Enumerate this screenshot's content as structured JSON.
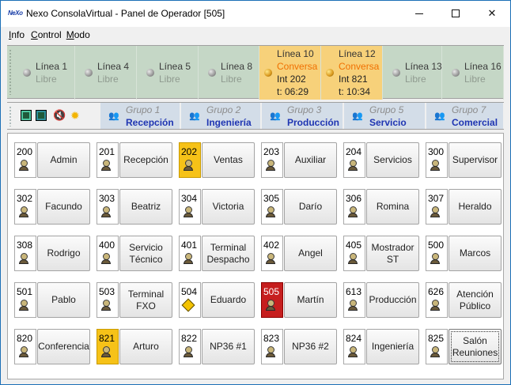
{
  "window": {
    "title": "Nexo ConsolaVirtual - Panel de Operador [505]",
    "logo_text": "NeXo"
  },
  "menu": [
    {
      "label": "Info",
      "accel": "I"
    },
    {
      "label": "Control",
      "accel": "C"
    },
    {
      "label": "Modo",
      "accel": "M"
    }
  ],
  "lines": [
    {
      "name": "Línea 1",
      "state": "Libre",
      "active": false
    },
    {
      "name": "Línea 4",
      "state": "Libre",
      "active": false
    },
    {
      "name": "Línea 5",
      "state": "Libre",
      "active": false
    },
    {
      "name": "Línea 8",
      "state": "Libre",
      "active": false
    },
    {
      "name": "Línea 10",
      "state": "Conversa",
      "ext": "Int 202",
      "time": "t: 06:29",
      "active": true
    },
    {
      "name": "Línea 12",
      "state": "Conversa",
      "ext": "Int 821",
      "time": "t: 10:34",
      "active": true
    },
    {
      "name": "Línea 13",
      "state": "Libre",
      "active": false
    },
    {
      "name": "Línea 16",
      "state": "Libre",
      "active": false
    }
  ],
  "toolbar_icons": [
    "monitor-icon",
    "monitor-alt-icon",
    "speaker-mute-icon",
    "sun-icon"
  ],
  "groups": [
    {
      "name": "Grupo 1",
      "label": "Recepción"
    },
    {
      "name": "Grupo 2",
      "label": "Ingeniería"
    },
    {
      "name": "Grupo 3",
      "label": "Producción"
    },
    {
      "name": "Grupo 5",
      "label": "Servicio"
    },
    {
      "name": "Grupo 7",
      "label": "Comercial"
    }
  ],
  "extensions": [
    [
      {
        "num": "200",
        "label": "Admin",
        "status": "idle"
      },
      {
        "num": "201",
        "label": "Recepción",
        "status": "idle"
      },
      {
        "num": "202",
        "label": "Ventas",
        "status": "busy"
      },
      {
        "num": "203",
        "label": "Auxiliar",
        "status": "idle"
      },
      {
        "num": "204",
        "label": "Servicios",
        "status": "idle"
      },
      {
        "num": "300",
        "label": "Supervisor",
        "status": "idle"
      }
    ],
    [
      {
        "num": "302",
        "label": "Facundo",
        "status": "idle"
      },
      {
        "num": "303",
        "label": "Beatriz",
        "status": "idle"
      },
      {
        "num": "304",
        "label": "Victoria",
        "status": "idle"
      },
      {
        "num": "305",
        "label": "Darío",
        "status": "idle"
      },
      {
        "num": "306",
        "label": "Romina",
        "status": "idle"
      },
      {
        "num": "307",
        "label": "Heraldo",
        "status": "idle"
      }
    ],
    [
      {
        "num": "308",
        "label": "Rodrigo",
        "status": "idle"
      },
      {
        "num": "400",
        "label": "Servicio Técnico",
        "status": "idle"
      },
      {
        "num": "401",
        "label": "Terminal Despacho",
        "status": "idle"
      },
      {
        "num": "402",
        "label": "Angel",
        "status": "idle"
      },
      {
        "num": "405",
        "label": "Mostrador ST",
        "status": "idle"
      },
      {
        "num": "500",
        "label": "Marcos",
        "status": "idle"
      }
    ],
    [
      {
        "num": "501",
        "label": "Pablo",
        "status": "idle"
      },
      {
        "num": "503",
        "label": "Terminal FXO",
        "status": "idle"
      },
      {
        "num": "504",
        "label": "Eduardo",
        "status": "parked"
      },
      {
        "num": "505",
        "label": "Martín",
        "status": "alert"
      },
      {
        "num": "613",
        "label": "Producción",
        "status": "idle"
      },
      {
        "num": "626",
        "label": "Atención Público",
        "status": "idle"
      }
    ],
    [
      {
        "num": "820",
        "label": "Conferencia",
        "status": "idle"
      },
      {
        "num": "821",
        "label": "Arturo",
        "status": "busy"
      },
      {
        "num": "822",
        "label": "NP36 #1",
        "status": "idle"
      },
      {
        "num": "823",
        "label": "NP36 #2",
        "status": "idle"
      },
      {
        "num": "824",
        "label": "Ingeniería",
        "status": "idle"
      },
      {
        "num": "825",
        "label": "Salón Reuniones",
        "status": "idle",
        "focused": true
      }
    ]
  ]
}
